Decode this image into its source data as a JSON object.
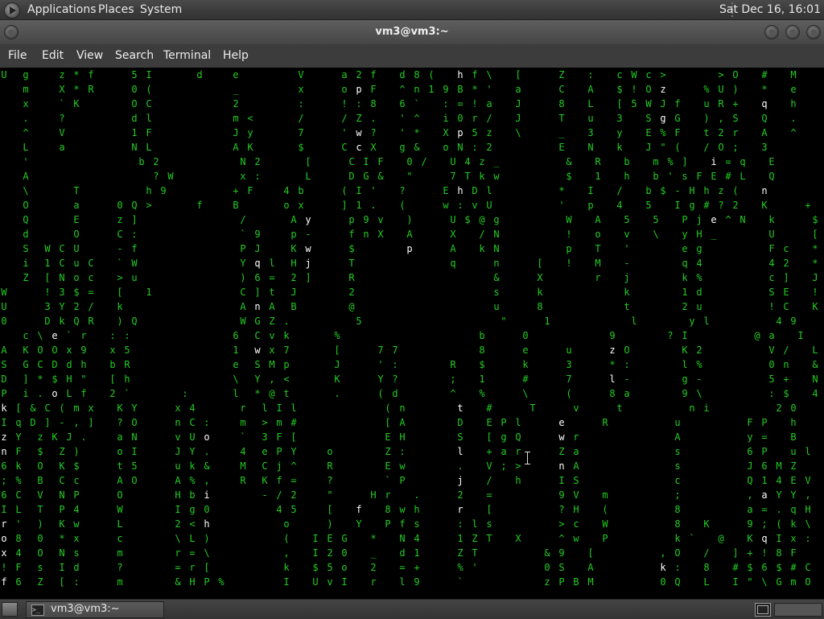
{
  "top_panel": {
    "menus": [
      "Applications",
      "Places",
      "System"
    ],
    "clock": "Sat Dec 16, 16:01"
  },
  "window": {
    "title": "vm3@vm3:~",
    "menus": [
      "File",
      "Edit",
      "View",
      "Search",
      "Terminal",
      "Help"
    ]
  },
  "terminal": {
    "text_color": "#22cc22",
    "highlight_color": "#ffffff",
    "rows": [
      "U  g    z * f     5 I      d    e        V     a 2 f   d 8 (   h f \\   [     Z   :   c W c >       > O   #   M     4 ?   o \"  >",
      "   m    X * R     0 (           _        x     o p F   ^ n 1 9 B * '   a     C   A   $ ! O z     % U )   *   e     1 ,   a /   s",
      "   x    ` K       O C           2        :     ! : 8   6 `   : = ! a   J     8   L   [ 5 W J f   u R +   q   h     x R ` M   \"",
      "   .    ?         d l           m <      /     / Z .   ' ^   i 0 r /   J     T   u   3   S g G   ) , S   Q   .     < 3 $ G   Z",
      "   ^    V         1 F           J y      7     ' w ?   ' *   X p 5 z   \\     _   3   y   E % F   t 2 r   A   ^     ( ? I G",
      "   L    a         N L           A K      $     C c X   g &   o N : 2         E   N   k   J \" (   / O ;   3         F / l W",
      "   '               b 2           N 2      [     C I F   0 /   U 4 z _         &   R   b   m % ]   i = q   E         t H * <",
      "   A                 ? W         x :      L     D G &   \"     7 T k w         $   1   h   b ' s F E # L   Q         h O H \" E",
      "   \\      T         h 9         + F    4 b     ( I '   ?     E h D l         *   I   /   b $ - H h z (   n         o 4 K # T",
      "   O      a     0 Q >      f    B      o x     ] 1 .   (     w : v U         '   p   4   5   I g # ? 2   K     +   + 1 z 0 j",
      "   Q      E     z ]              /      A y     p 9 v   )     U $ @ g         W   A   5   5   P j e ^ N   k     $   Z ! Y 3 0",
      "   d      O     C :              ` 9    p -     f n X   A     X   / N         !   o   v   \\   y H _       U     [   N   I 4 Y",
      "   S  W C U     - f              P J    K w     $       p     A   k N         p   T   '       e g         F c   *     8 I a",
      "   i  1 C u C   ` W              Y q l  H j     T             q     n     [   !   M   -       q 4         4 2   *     I s d f",
      "   Z  [ N o c   > u              ) 6 =  2 ]     R                   &     X       r   j       k %         c ]   J     0 q ^ R",
      "W     ! 3 $ =   [   1            C ] t  J       2                   s     k           k       1 d         S E   !     K @ R",
      "U     3 Y 2 /   k                A n A  B       @                   u     8           t       2 u         ! C   K     g b (",
      "0     D k Q R   ) Q              W G Z .         5                   \"     1           l       y l         4 9   (     9 + [",
      "   c \\ e ` r   : :              6  C v k      %                   b     0           9       ? I         @ a   I     `   u",
      "A  K O O x 9   x 5              1  w x 7      [     7 7           8     e     u     z O       K 2         V /   L     +   +",
      "S  G C D d h   b R              e  S M p      J     ' :       R   $     k     3     * :       l %         0 n   &     &   j",
      "D  ] * $ H \"   [ h              \\  Y , <      K     Y ?       ;   1     #     7     l -       g -         5 +   N     ;   (",
      "P  i . o L f   2 `       :      l  * @ t      .     ( d       ^   %     \\     (     8 a       9 \\         : $   4     /   `",
      "k [ & C ( m x   K Y     x 4      r  l I l            ( n       t   #     T     v     t         n i         2 0   2       q   -",
      "I q D ] - , ]   ? O     n C :    m  > m #            [ A       D   E P l     e     R         u         F P   h         T",
      "z Y  z K J .    a N     v U o    `  3 F [            E H       S   [ g Q     w r             A         y =   B         g",
      "n F  $  Z )     o I     J Y .    4  e P Y    o       Z :       l   + a r     Z a             s         6 P   u l",
      "6 k  O  K $     t 5     u k &    M  C j ^    R       E w       .   V ; >     n A             s         J 6 M Z   e p",
      "; %  B  C c     A O     A % ,    R  K f =    ?       ` P       j   /   h     I S             c         Q 1 4 E V",
      "6 C  V  N P     O       H b i       - / 2    \"     H r   .     2   =         9 V   m         ;         , a Y Y ,",
      "I L  T  P 4     W       I g 0         4 5    [   f   8 w h     r   [         ? H   (         8         a = . q H",
      "r '  )  K w     L       2 < h          o     )   Y   P f s     : l s         > c   W         8   K     9 ; ( k \\",
      "o 8  0  * x     c       \\ L )          (   I E G   *   N 4     1 Z T   X     ^ w   P         k `   @   K q I x :",
      "x 4  O  N s     m       r = \\          ,   I 2 0   _   d 1     Z T         & 9   [         , O   /   ] + ! 8 F",
      "! F  s  I d     ?       = r [          k   $ 5 o   2   = +     % '         0 S   A         k :   8   # $ 6 $ # C",
      "f 6  Z  [ :     m       & H P %        I   U v I   r   l 9     `           z P B M         0 Q   L   I \" \\ G m O"
    ]
  }
}
